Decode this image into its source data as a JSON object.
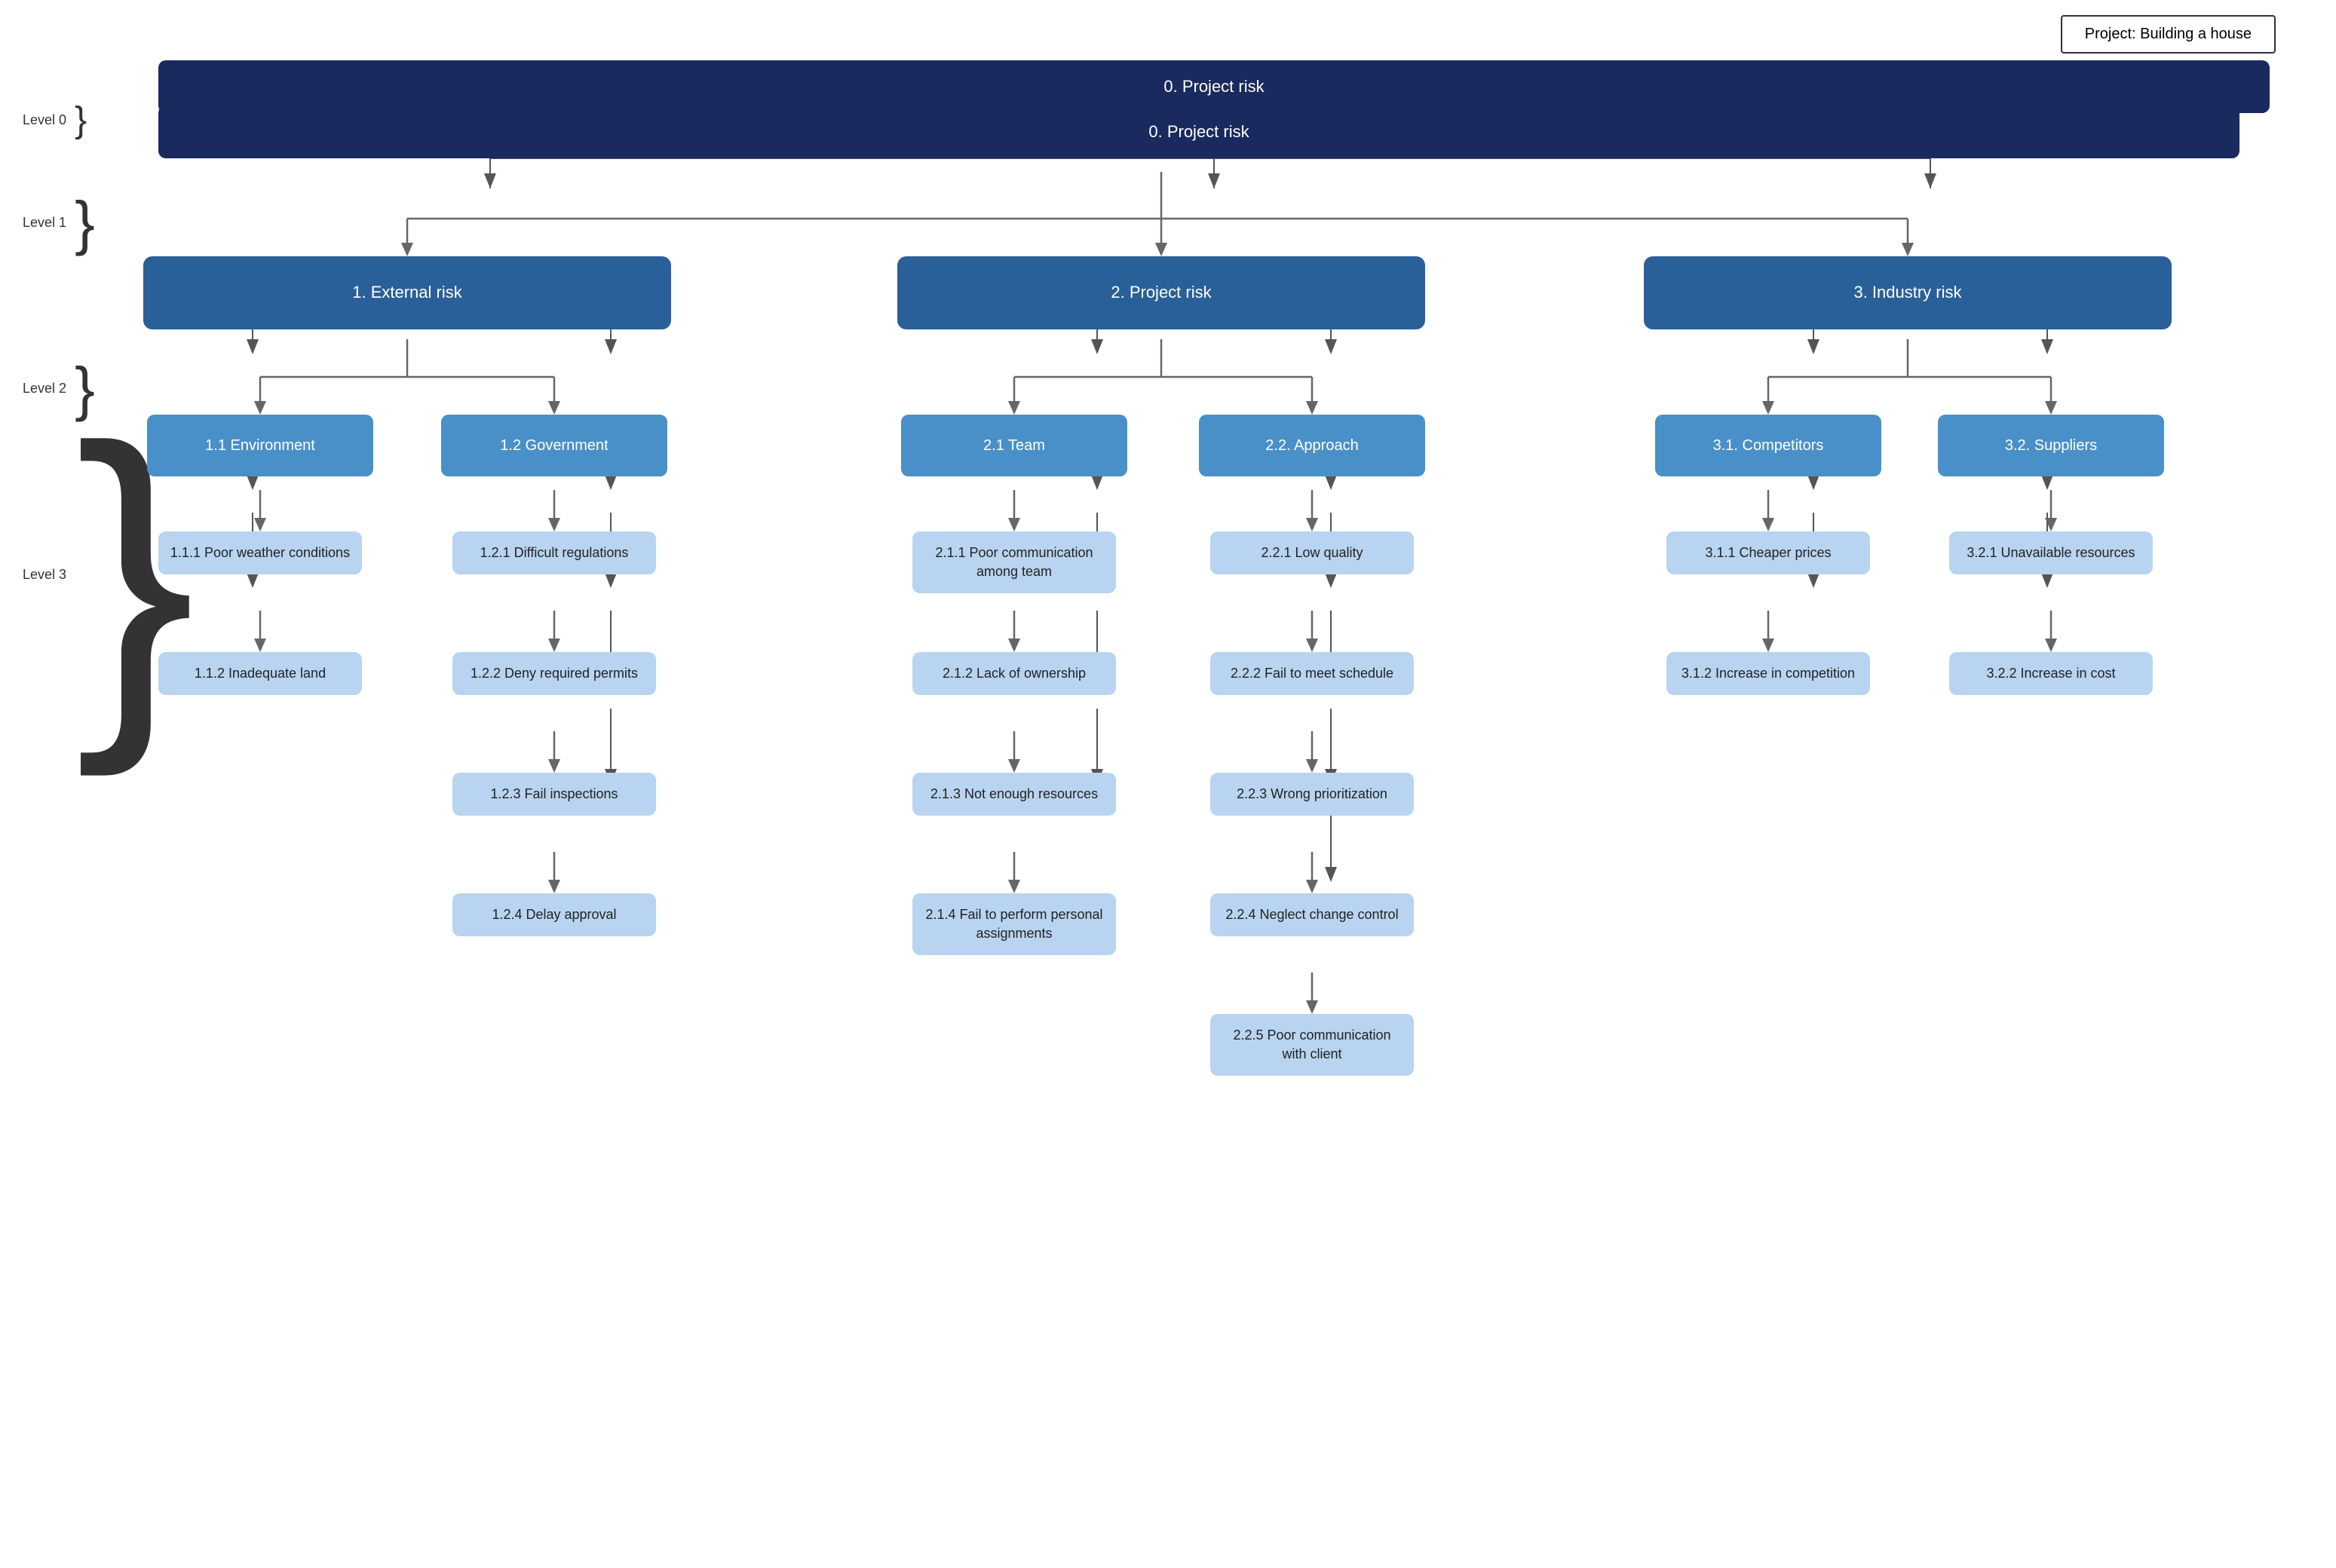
{
  "project": {
    "title": "Project: Building a house"
  },
  "levels": {
    "level0": "Level 0",
    "level1": "Level 1",
    "level2": "Level 2",
    "level3": "Level 3"
  },
  "nodes": {
    "root": "0. Project risk",
    "l1": [
      "1. External risk",
      "2. Project risk",
      "3. Industry risk"
    ],
    "l2": [
      "1.1 Environment",
      "1.2 Government",
      "2.1 Team",
      "2.2. Approach",
      "3.1. Competitors",
      "3.2. Suppliers"
    ],
    "l3": {
      "env": [
        "1.1.1 Poor weather conditions",
        "1.1.2 Inadequate land"
      ],
      "gov": [
        "1.2.1 Difficult regulations",
        "1.2.2 Deny required permits",
        "1.2.3 Fail inspections",
        "1.2.4 Delay approval"
      ],
      "team": [
        "2.1.1 Poor communication among team",
        "2.1.2 Lack of ownership",
        "2.1.3 Not enough resources",
        "2.1.4 Fail to perform personal assignments"
      ],
      "approach": [
        "2.2.1 Low quality",
        "2.2.2 Fail to meet schedule",
        "2.2.3 Wrong prioritization",
        "2.2.4 Neglect change control",
        "2.2.5 Poor communication with client"
      ],
      "competitors": [
        "3.1.1 Cheaper prices",
        "3.1.2 Increase in competition"
      ],
      "suppliers": [
        "3.2.1 Unavailable resources",
        "3.2.2 Increase in cost"
      ]
    }
  }
}
